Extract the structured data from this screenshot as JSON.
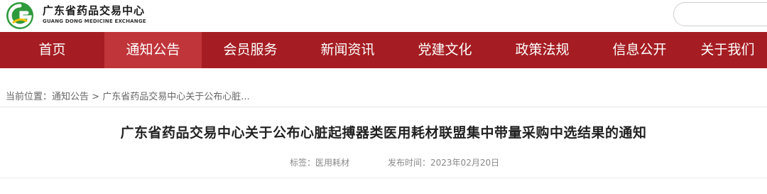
{
  "header": {
    "brand_cn": "广东省药品交易中心",
    "brand_en": "GUANG DONG MEDICINE EXCHANGE",
    "logo_letter": "G",
    "search": {
      "value": "",
      "placeholder": ""
    }
  },
  "nav": {
    "items": [
      {
        "label": "首页"
      },
      {
        "label": "通知公告"
      },
      {
        "label": "会员服务"
      },
      {
        "label": "新闻资讯"
      },
      {
        "label": "党建文化"
      },
      {
        "label": "政策法规"
      },
      {
        "label": "信息公开"
      },
      {
        "label": "关于我们"
      }
    ],
    "active": "通知公告"
  },
  "breadcrumb": {
    "prefix": "当前位置：",
    "section": "通知公告",
    "separator": " > ",
    "current": "广东省药品交易中心关于公布心脏..."
  },
  "article": {
    "title": "广东省药品交易中心关于公布心脏起搏器类医用耗材联盟集中带量采购中选结果的通知",
    "tag_label": "标签：",
    "tag_value": "医用耗材",
    "date_label": "发布时间：",
    "date_value": "2023年02月20日"
  },
  "colors": {
    "nav_bg": "#a51d22",
    "nav_active_bg": "#c0353a",
    "logo_green": "#2e9a3c",
    "logo_yellow": "#f2c200"
  }
}
